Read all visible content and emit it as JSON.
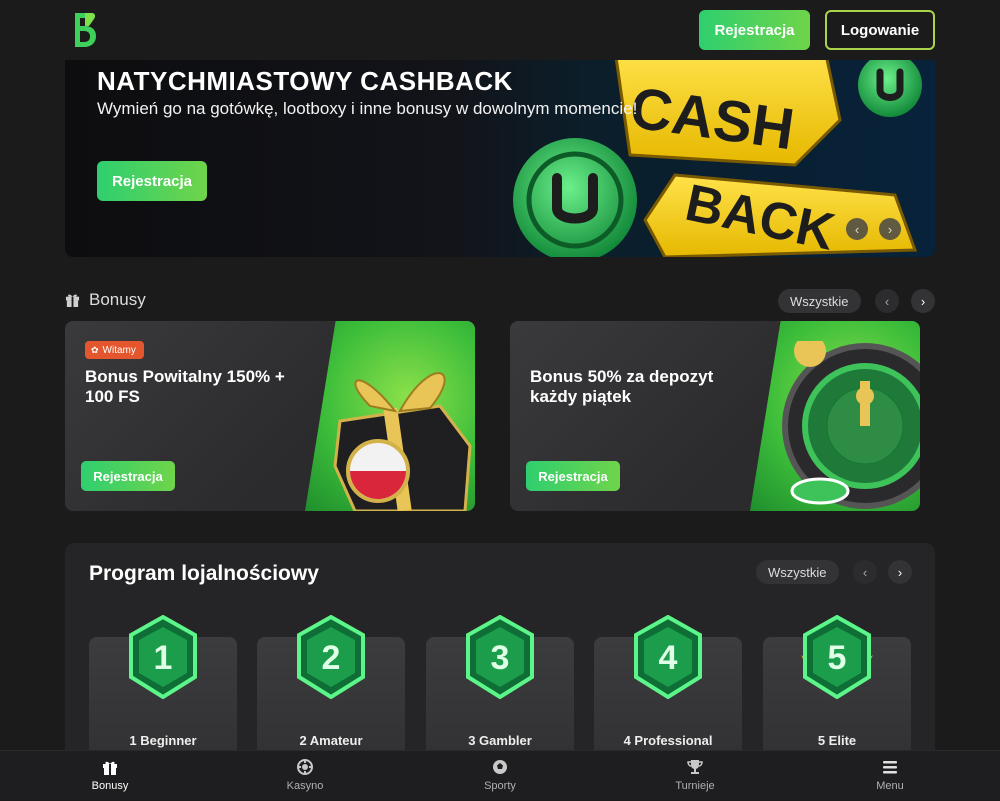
{
  "header": {
    "register_label": "Rejestracja",
    "login_label": "Logowanie"
  },
  "hero": {
    "title": "NATYCHMIASTOWY CASHBACK",
    "subtitle": "Wymień go na gotówkę, lootboxy i inne bonusy w dowolnym momencie!",
    "button_label": "Rejestracja",
    "art_text_1": "CASH",
    "art_text_2": "BACK"
  },
  "bonuses": {
    "title": "Bonusy",
    "all_label": "Wszystkie",
    "cards": [
      {
        "badge": "Witamy",
        "title": "Bonus Powitalny 150% + 100 FS",
        "button_label": "Rejestracja"
      },
      {
        "title": "Bonus 50% za depozyt każdy piątek",
        "button_label": "Rejestracja"
      }
    ]
  },
  "loyalty": {
    "title": "Program lojalnościowy",
    "all_label": "Wszystkie",
    "tiers": [
      {
        "number": "1",
        "label": "1 Beginner"
      },
      {
        "number": "2",
        "label": "2 Amateur"
      },
      {
        "number": "3",
        "label": "3 Gambler"
      },
      {
        "number": "4",
        "label": "4 Professional"
      },
      {
        "number": "5",
        "label": "5 Elite"
      }
    ]
  },
  "nav": {
    "items": [
      {
        "label": "Bonusy",
        "icon": "gift-icon"
      },
      {
        "label": "Kasyno",
        "icon": "casino-chip-icon"
      },
      {
        "label": "Sporty",
        "icon": "ball-icon"
      },
      {
        "label": "Turnieje",
        "icon": "trophy-icon"
      },
      {
        "label": "Menu",
        "icon": "menu-icon"
      }
    ]
  },
  "colors": {
    "accent_green": "#2fcf6f",
    "accent_lime": "#a9d44b",
    "badge_orange": "#e4572e",
    "background": "#1b1b1c"
  }
}
